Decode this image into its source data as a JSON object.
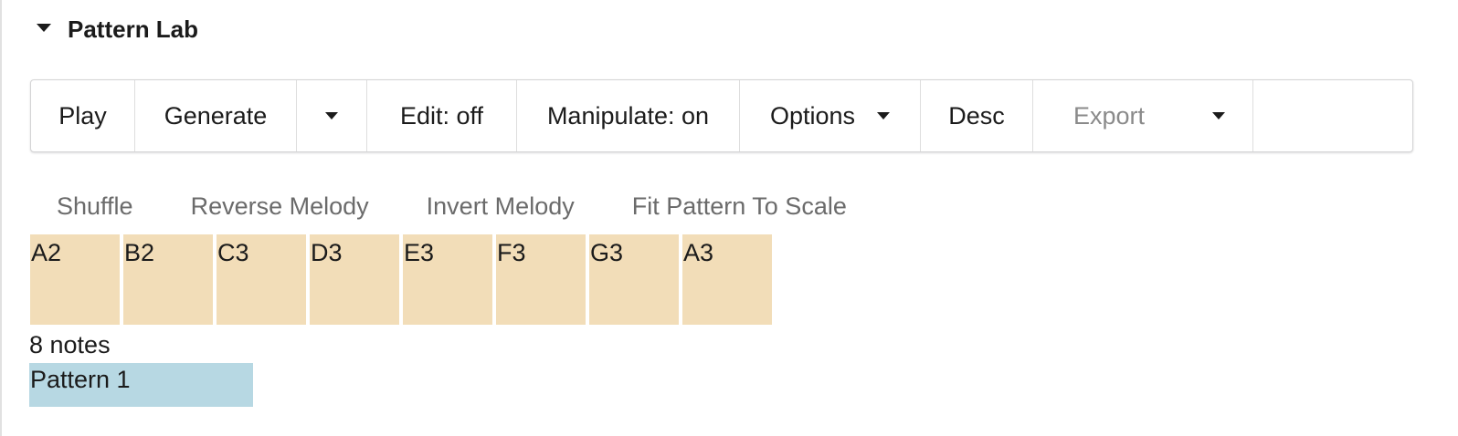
{
  "section": {
    "title": "Pattern Lab",
    "expanded_icon": "caret-down-icon"
  },
  "toolbar": {
    "play_label": "Play",
    "generate_label": "Generate",
    "generate_dropdown_icon": "caret-down-icon",
    "edit_label": "Edit: off",
    "manipulate_label": "Manipulate: on",
    "options_label": "Options",
    "desc_label": "Desc",
    "export_label": "Export"
  },
  "manipulations": [
    {
      "label": "Shuffle"
    },
    {
      "label": "Reverse Melody"
    },
    {
      "label": "Invert Melody"
    },
    {
      "label": "Fit Pattern To Scale"
    }
  ],
  "notes": [
    "A2",
    "B2",
    "C3",
    "D3",
    "E3",
    "F3",
    "G3",
    "A3"
  ],
  "note_count": "8 notes",
  "patterns": [
    {
      "label": "Pattern 1"
    }
  ],
  "colors": {
    "note_cell": "#f2ddb8",
    "pattern_chip": "#b7d8e3",
    "disabled_text": "#8a8a8a",
    "link_text": "#6b6b6b"
  }
}
